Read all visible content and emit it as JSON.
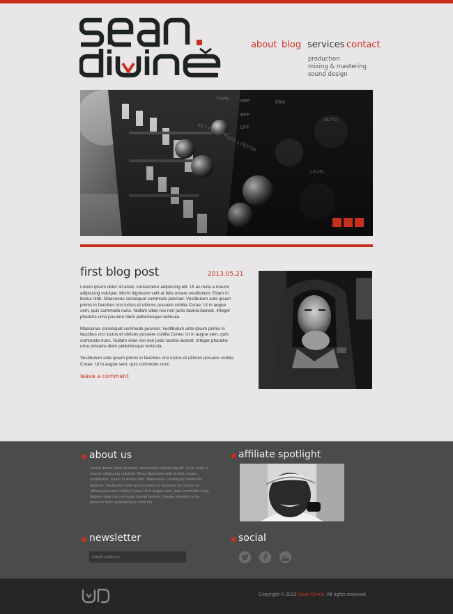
{
  "brand": {
    "line1": "sean.",
    "line2": "divine"
  },
  "nav": {
    "items": [
      {
        "label": "about",
        "active": false
      },
      {
        "label": "blog",
        "active": false
      },
      {
        "label": "services",
        "active": true
      },
      {
        "label": "contact",
        "active": false
      }
    ],
    "submenu": [
      "production",
      "mixing & mastering",
      "sound design"
    ]
  },
  "slider": {
    "slides": 3
  },
  "post": {
    "title": "first blog post",
    "date": "2013.05.21",
    "paragraphs": [
      "Lorem ipsum dolor sit amet, consectetur adipiscing elit. Ut ac nulla a mauris adipiscing volutpat. Morbi dignissim velit at felis ornare vestibulum. Etiam in lectus nibh. Maecenas consequat commodo pulvinar. Vestibulum ante ipsum primis in faucibus orci luctus et ultrices posuere cubilia Curae; Ut in augue sem, quis commodo nunc. Nullam vitae nisi non justo lacinia laoreet. Integer pharetra urna posuere diam pellentesque vehicula.",
      "Maecenas consequat commodo pulvinar. Vestibulum ante ipsum primis in faucibus orci luctus et ultrices posuere cubilia Curae; Ut in augue sem, quis commodo nunc. Nullam vitae nisi non justo lacinia laoreet. Integer pharetra urna posuere diam pellentesque vehicula.",
      "Vestibulum ante ipsum primis in faucibus orci luctus et ultrices posuere cubilia Curae; Ut in augue sem, quis commodo nunc."
    ],
    "comment_link": "leave a comment"
  },
  "footer": {
    "about": {
      "title": "about us",
      "text": "Lorem ipsum dolor sit amet, consectetur adipiscing elit. Ut ac nulla a mauris adipiscing volutpat. Morbi dignissim velit at felis ornare vestibulum. Etiam in lectus nibh. Maecenas consequat commodo pulvinar. Vestibulum ante ipsum primis in faucibus orci luctus et ultrices posuere cubilia Curae; Ut in augue sem, quis commodo nunc. Nullam vitae nisi non justo lacinia laoreet. Integer pharetra urna posuere diam pellentesque vehicula."
    },
    "spotlight": {
      "title": "affiliate spotlight"
    },
    "newsletter": {
      "title": "newsletter",
      "placeholder": "email address"
    },
    "social": {
      "title": "social",
      "icons": [
        "twitter-icon",
        "facebook-icon",
        "youtube-icon"
      ]
    }
  },
  "copyright": {
    "prefix": "Copyright © 2013 ",
    "brand": "Sean Divine",
    "suffix": ". All rights reserved."
  },
  "colors": {
    "accent": "#c8301e",
    "background": "#e9e6e7",
    "footer": "#4b4b4b",
    "bottombar": "#262626"
  }
}
